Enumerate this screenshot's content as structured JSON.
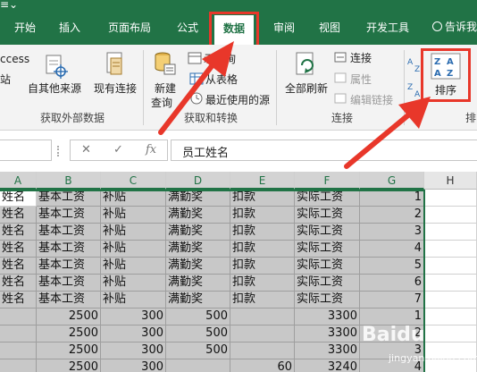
{
  "colors": {
    "ribbon_green": "#217346",
    "highlight_red": "#e8372a",
    "selected_fill": "#c8c8c8"
  },
  "tabs": [
    {
      "label": "开始"
    },
    {
      "label": "插入"
    },
    {
      "label": "页面布局"
    },
    {
      "label": "公式"
    },
    {
      "label": "数据"
    },
    {
      "label": "审阅"
    },
    {
      "label": "视图"
    },
    {
      "label": "开发工具"
    }
  ],
  "active_tab": "数据",
  "tell_me": "告诉我",
  "ribbon": {
    "left_cut": "ccess",
    "left_cut2": "站",
    "other_sources": "自其他来源",
    "existing_connections": "现有连接",
    "new_query": "新建",
    "new_query2": "查询",
    "show_query": "示查询",
    "from_table": "从表格",
    "recent_sources": "最近使用的源",
    "refresh_all": "全部刷新",
    "connections": "连接",
    "properties": "属性",
    "edit_links": "编辑链接",
    "sort": "排序",
    "group_get_external": "获取外部数据",
    "group_get_transform": "获取和转换",
    "group_connections": "连接",
    "group_sort_cut": "排"
  },
  "formula_bar": {
    "fx": "fx",
    "cancel": "✕",
    "confirm": "✓",
    "content": "员工姓名"
  },
  "columns": [
    "A",
    "B",
    "C",
    "D",
    "E",
    "F",
    "G",
    "H"
  ],
  "rows": [
    [
      "姓名",
      "基本工资",
      "补贴",
      "满勤奖",
      "扣款",
      "实际工资",
      "1"
    ],
    [
      "姓名",
      "基本工资",
      "补贴",
      "满勤奖",
      "扣款",
      "实际工资",
      "2"
    ],
    [
      "姓名",
      "基本工资",
      "补贴",
      "满勤奖",
      "扣款",
      "实际工资",
      "3"
    ],
    [
      "姓名",
      "基本工资",
      "补贴",
      "满勤奖",
      "扣款",
      "实际工资",
      "4"
    ],
    [
      "姓名",
      "基本工资",
      "补贴",
      "满勤奖",
      "扣款",
      "实际工资",
      "5"
    ],
    [
      "姓名",
      "基本工资",
      "补贴",
      "满勤奖",
      "扣款",
      "实际工资",
      "6"
    ],
    [
      "姓名",
      "基本工资",
      "补贴",
      "满勤奖",
      "扣款",
      "实际工资",
      "7"
    ],
    [
      "",
      "2500",
      "300",
      "500",
      "",
      "3300",
      "1"
    ],
    [
      "",
      "2500",
      "300",
      "500",
      "",
      "3300",
      "2"
    ],
    [
      "",
      "2500",
      "300",
      "500",
      "",
      "3300",
      "3"
    ],
    [
      "",
      "2500",
      "300",
      "",
      "60",
      "3240",
      "4"
    ]
  ],
  "watermark": {
    "text": "Baidu",
    "sub": "jingyan.baidu.com"
  }
}
